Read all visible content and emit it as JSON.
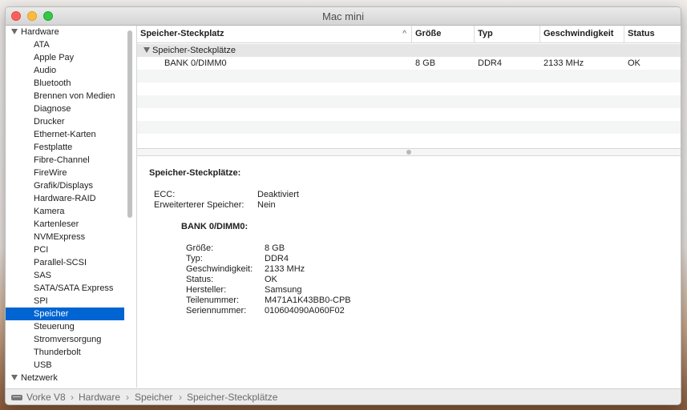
{
  "window": {
    "title": "Mac mini"
  },
  "sidebar": {
    "groups": [
      {
        "label": "Hardware",
        "items": [
          "ATA",
          "Apple Pay",
          "Audio",
          "Bluetooth",
          "Brennen von Medien",
          "Diagnose",
          "Drucker",
          "Ethernet-Karten",
          "Festplatte",
          "Fibre-Channel",
          "FireWire",
          "Grafik/Displays",
          "Hardware-RAID",
          "Kamera",
          "Kartenleser",
          "NVMExpress",
          "PCI",
          "Parallel-SCSI",
          "SAS",
          "SATA/SATA Express",
          "SPI",
          "Speicher",
          "Steuerung",
          "Stromversorgung",
          "Thunderbolt",
          "USB"
        ]
      },
      {
        "label": "Netzwerk",
        "items": []
      }
    ],
    "selected": "Speicher"
  },
  "table": {
    "columns": [
      "Speicher-Steckplatz",
      "Größe",
      "Typ",
      "Geschwindigkeit",
      "Status"
    ],
    "group_label": "Speicher-Steckplätze",
    "rows": [
      {
        "slot": "BANK 0/DIMM0",
        "size": "8 GB",
        "type": "DDR4",
        "speed": "2133 MHz",
        "status": "OK"
      }
    ]
  },
  "detail": {
    "heading": "Speicher-Steckplätze:",
    "ecc_label": "ECC:",
    "ecc_value": "Deaktiviert",
    "ext_label": "Erweiterterer Speicher:",
    "ext_value": "Nein",
    "bank_heading": "BANK 0/DIMM0:",
    "fields": [
      {
        "label": "Größe:",
        "value": "8 GB"
      },
      {
        "label": "Typ:",
        "value": "DDR4"
      },
      {
        "label": "Geschwindigkeit:",
        "value": "2133 MHz"
      },
      {
        "label": "Status:",
        "value": "OK"
      },
      {
        "label": "Hersteller:",
        "value": "Samsung"
      },
      {
        "label": "Teilenummer:",
        "value": "M471A1K43BB0-CPB"
      },
      {
        "label": "Seriennummer:",
        "value": "010604090A060F02"
      }
    ]
  },
  "statusbar": {
    "path": [
      "Vorke V8",
      "Hardware",
      "Speicher",
      "Speicher-Steckplätze"
    ],
    "separator": "›"
  },
  "colors": {
    "selection": "#0064d2",
    "close": "#fc605c",
    "minimize": "#fdbc40",
    "maximize": "#34c84a"
  }
}
